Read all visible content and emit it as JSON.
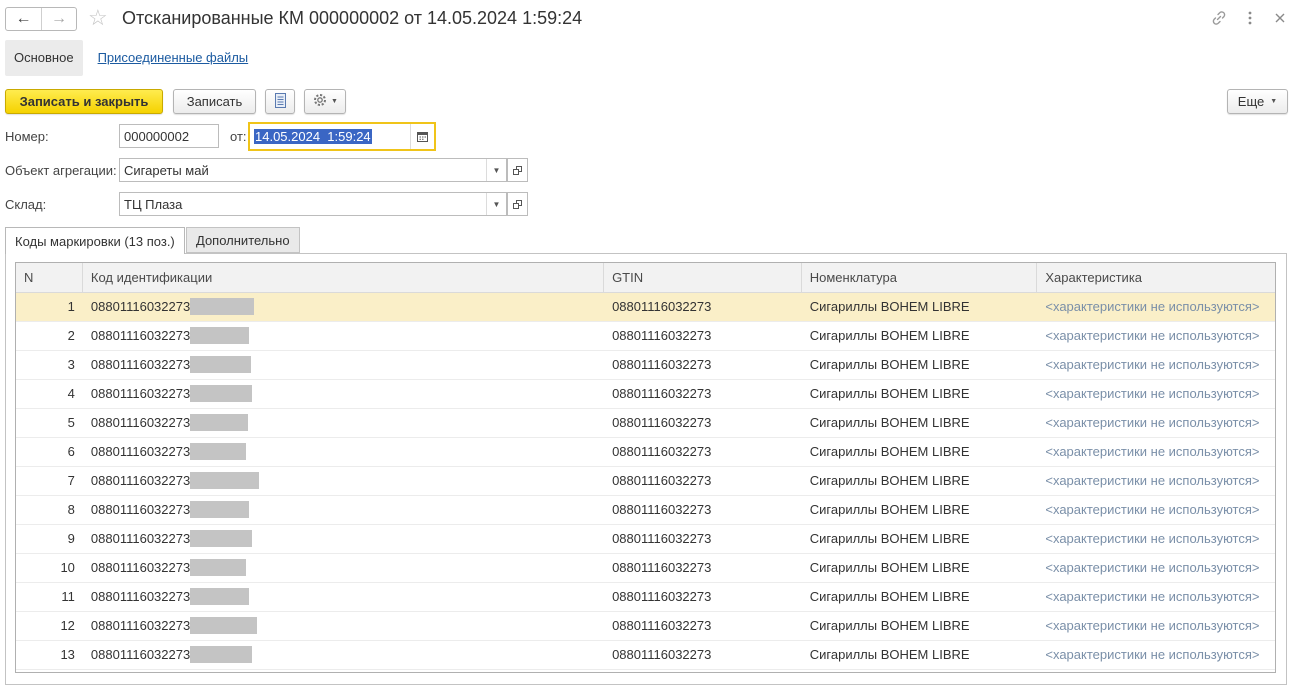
{
  "window": {
    "title": "Отсканированные КМ 000000002 от 14.05.2024 1:59:24"
  },
  "form_tabs": {
    "main": "Основное",
    "attached": "Присоединенные файлы"
  },
  "toolbar": {
    "save_close": "Записать и закрыть",
    "save": "Записать",
    "more": "Еще"
  },
  "fields": {
    "number_label": "Номер:",
    "number_value": "000000002",
    "date_label": "от:",
    "date_value": "14.05.2024  1:59:24",
    "aggregation_label": "Объект агрегации:",
    "aggregation_value": "Сигареты май",
    "warehouse_label": "Склад:",
    "warehouse_value": "ТЦ Плаза"
  },
  "page_tabs": {
    "codes": "Коды маркировки (13 поз.)",
    "extra": "Дополнительно"
  },
  "table": {
    "columns": [
      "N",
      "Код идентификации",
      "GTIN",
      "Номенклатура",
      "Характеристика"
    ],
    "rows": [
      {
        "n": "1",
        "code": "08801116032273",
        "gtin": "08801116032273",
        "item": "Сигариллы BOHEM LIBRE",
        "char": "<характеристики не используются>"
      },
      {
        "n": "2",
        "code": "08801116032273",
        "gtin": "08801116032273",
        "item": "Сигариллы BOHEM LIBRE",
        "char": "<характеристики не используются>"
      },
      {
        "n": "3",
        "code": "08801116032273",
        "gtin": "08801116032273",
        "item": "Сигариллы BOHEM LIBRE",
        "char": "<характеристики не используются>"
      },
      {
        "n": "4",
        "code": "08801116032273",
        "gtin": "08801116032273",
        "item": "Сигариллы BOHEM LIBRE",
        "char": "<характеристики не используются>"
      },
      {
        "n": "5",
        "code": "08801116032273",
        "gtin": "08801116032273",
        "item": "Сигариллы BOHEM LIBRE",
        "char": "<характеристики не используются>"
      },
      {
        "n": "6",
        "code": "08801116032273",
        "gtin": "08801116032273",
        "item": "Сигариллы BOHEM LIBRE",
        "char": "<характеристики не используются>"
      },
      {
        "n": "7",
        "code": "08801116032273",
        "gtin": "08801116032273",
        "item": "Сигариллы BOHEM LIBRE",
        "char": "<характеристики не используются>"
      },
      {
        "n": "8",
        "code": "08801116032273",
        "gtin": "08801116032273",
        "item": "Сигариллы BOHEM LIBRE",
        "char": "<характеристики не используются>"
      },
      {
        "n": "9",
        "code": "08801116032273",
        "gtin": "08801116032273",
        "item": "Сигариллы BOHEM LIBRE",
        "char": "<характеристики не используются>"
      },
      {
        "n": "10",
        "code": "08801116032273",
        "gtin": "08801116032273",
        "item": "Сигариллы BOHEM LIBRE",
        "char": "<характеристики не используются>"
      },
      {
        "n": "11",
        "code": "08801116032273",
        "gtin": "08801116032273",
        "item": "Сигариллы BOHEM LIBRE",
        "char": "<характеристики не используются>"
      },
      {
        "n": "12",
        "code": "08801116032273",
        "gtin": "08801116032273",
        "item": "Сигариллы BOHEM LIBRE",
        "char": "<характеристики не используются>"
      },
      {
        "n": "13",
        "code": "08801116032273",
        "gtin": "08801116032273",
        "item": "Сигариллы BOHEM LIBRE",
        "char": "<характеристики не используются>"
      }
    ]
  },
  "colors": {
    "primary_button": "#f5d200",
    "focus_border": "#f0c419",
    "selected_row": "#faefc8",
    "link": "#1c5ba1",
    "placeholder_text": "#7a8fa8"
  }
}
